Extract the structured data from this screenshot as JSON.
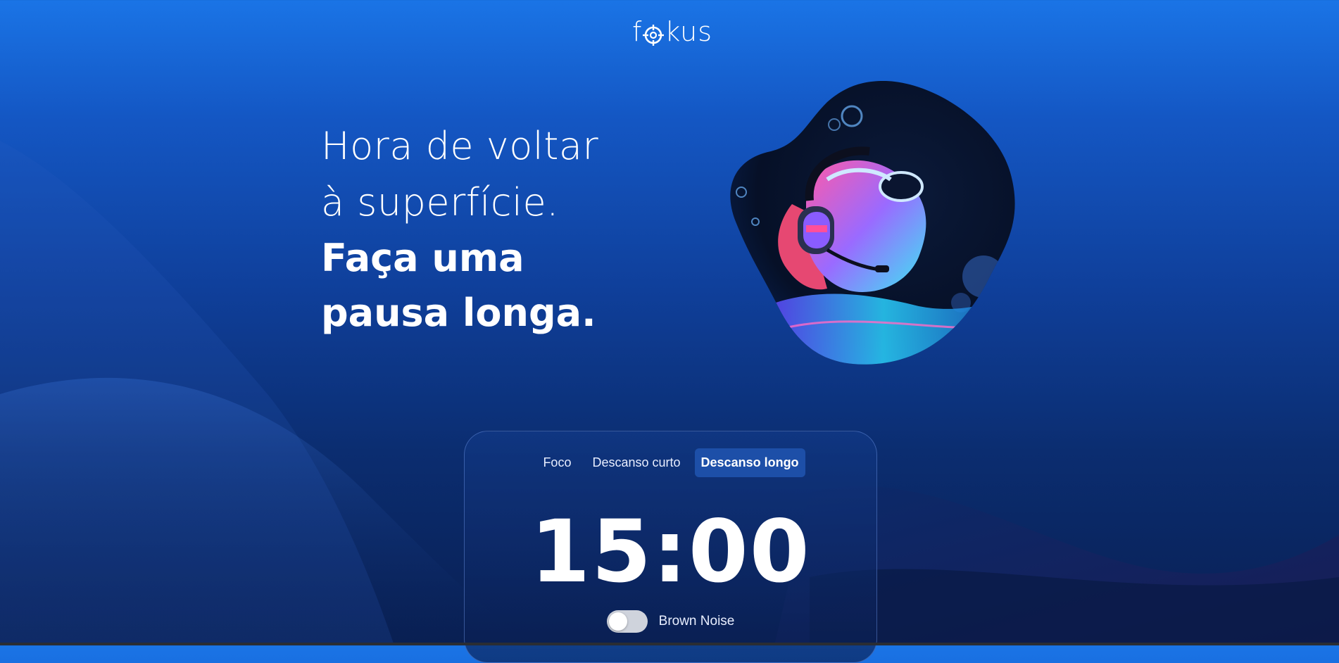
{
  "app": {
    "logo_text_left": "f",
    "logo_text_right": "kus",
    "logo_icon": "target-icon"
  },
  "hero": {
    "line1": "Hora de voltar",
    "line2": "à superfície.",
    "strong1": "Faça uma",
    "strong2": "pausa longa.",
    "image_icon": "diver-with-headphones-illustration"
  },
  "timer_card": {
    "tabs": [
      {
        "label": "Foco",
        "active": false
      },
      {
        "label": "Descanso curto",
        "active": false
      },
      {
        "label": "Descanso longo",
        "active": true
      }
    ],
    "time": "15:00",
    "toggle_label": "Brown Noise",
    "toggle_on": false
  },
  "colors": {
    "bg_top": "#1a74e6",
    "bg_bottom": "#091f52",
    "active_tab": "#1d4fa8",
    "accent_cyan": "#35e0f0",
    "accent_pink": "#ff4f9a"
  }
}
